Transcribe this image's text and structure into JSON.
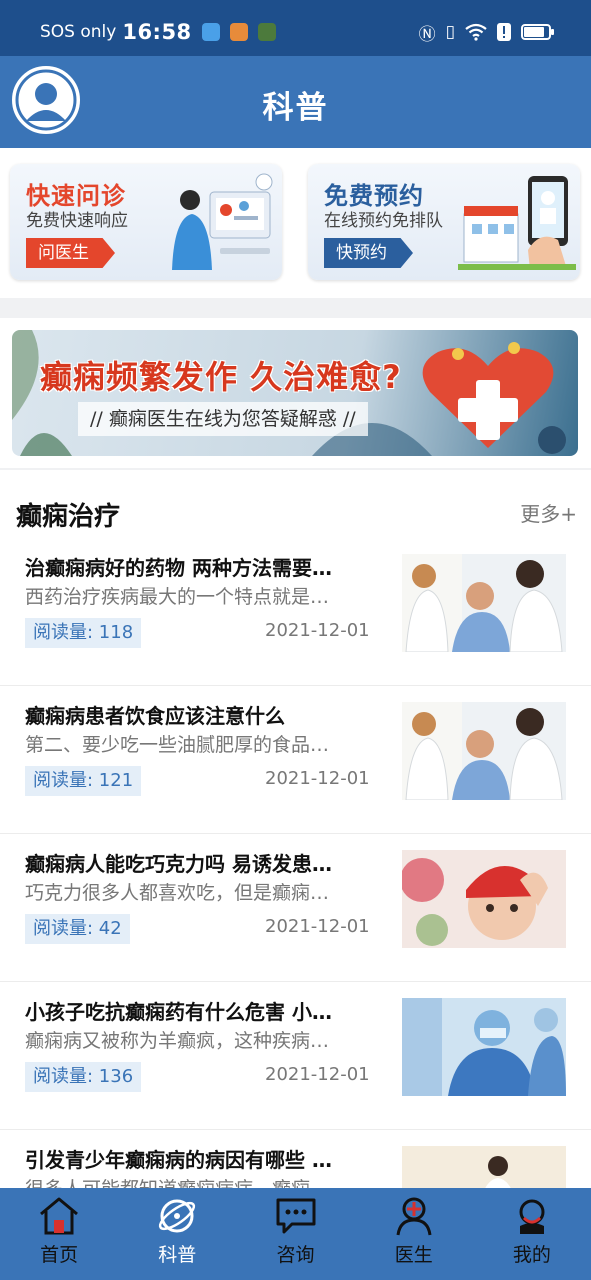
{
  "status_bar": {
    "carrier": "SOS only",
    "time": "16:58",
    "battery_level": 0.85,
    "indicators": [
      "nfc-icon",
      "vibrate-icon",
      "wifi-icon",
      "alert-icon",
      "battery-icon"
    ]
  },
  "header": {
    "title": "科普"
  },
  "quick_actions": [
    {
      "title": "快速问诊",
      "subtitle": "免费快速响应",
      "button": "问医生",
      "accent": "#e4462c"
    },
    {
      "title": "免费预约",
      "subtitle": "在线预约免排队",
      "button": "快预约",
      "accent": "#2b5f9e"
    }
  ],
  "banner": {
    "title": "癫痫频繁发作 久治难愈?",
    "subtitle": "// 癫痫医生在线为您答疑解惑 //"
  },
  "section": {
    "title": "癫痫治疗",
    "more": "更多+"
  },
  "articles": [
    {
      "title": "治癫痫病好的药物 两种方法需要…",
      "excerpt": "西药治疗疾病最大的一个特点就是…",
      "views": "阅读量: 118",
      "date": "2021-12-01",
      "thumb": "doctor-patient"
    },
    {
      "title": "癫痫病患者饮食应该注意什么",
      "excerpt": "第二、要少吃一些油腻肥厚的食品…",
      "views": "阅读量: 121",
      "date": "2021-12-01",
      "thumb": "doctor-patient"
    },
    {
      "title": "癫痫病人能吃巧克力吗 易诱发患…",
      "excerpt": "巧克力很多人都喜欢吃，但是癫痫…",
      "views": "阅读量: 42",
      "date": "2021-12-01",
      "thumb": "child"
    },
    {
      "title": "小孩子吃抗癫痫药有什么危害 小…",
      "excerpt": "癫痫病又被称为羊癫疯，这种疾病…",
      "views": "阅读量: 136",
      "date": "2021-12-01",
      "thumb": "surgery"
    },
    {
      "title": "引发青少年癫痫病的病因有哪些 …",
      "excerpt": "很多人可能都知道癫痫病症，癫痫…",
      "views": "",
      "date": "",
      "thumb": "nurse"
    }
  ],
  "tabs": [
    {
      "label": "首页",
      "icon": "home-icon",
      "active": false
    },
    {
      "label": "科普",
      "icon": "science-icon",
      "active": true
    },
    {
      "label": "咨询",
      "icon": "chat-icon",
      "active": false
    },
    {
      "label": "医生",
      "icon": "doctor-icon",
      "active": false
    },
    {
      "label": "我的",
      "icon": "profile-icon",
      "active": false
    }
  ],
  "colors": {
    "status_bar": "#1e4f8c",
    "header": "#3a74b7",
    "accent_red": "#e4462c",
    "accent_blue": "#2b5f9e",
    "view_badge_bg": "#e4eef8"
  }
}
